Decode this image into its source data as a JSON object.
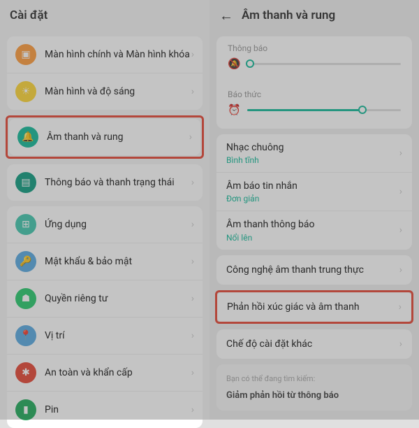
{
  "left": {
    "title": "Cài đặt",
    "groups": [
      [
        {
          "icon": "image-icon",
          "color": "icon-orange",
          "label": "Màn hình chính và Màn hình khóa"
        },
        {
          "icon": "brightness-icon",
          "color": "icon-yellow",
          "label": "Màn hình và độ sáng"
        }
      ],
      [
        {
          "icon": "bell-icon",
          "color": "icon-green",
          "label": "Âm thanh và rung",
          "highlight": true
        }
      ],
      [
        {
          "icon": "notification-icon",
          "color": "icon-teal-d",
          "label": "Thông báo và thanh trạng thái"
        }
      ],
      [
        {
          "icon": "apps-icon",
          "color": "icon-teal",
          "label": "Ứng dụng"
        },
        {
          "icon": "lock-icon",
          "color": "icon-blue",
          "label": "Mật khẩu & bảo mật"
        },
        {
          "icon": "privacy-icon",
          "color": "icon-greenl",
          "label": "Quyền riêng tư"
        },
        {
          "icon": "location-icon",
          "color": "icon-blue",
          "label": "Vị trí"
        },
        {
          "icon": "emergency-icon",
          "color": "icon-red",
          "label": "An toàn và khẩn cấp"
        },
        {
          "icon": "battery-icon",
          "color": "icon-greenb",
          "label": "Pin"
        }
      ]
    ]
  },
  "right": {
    "title": "Âm thanh và rung",
    "sliders": [
      {
        "label": "Thông báo",
        "icon": "bell-off-icon",
        "value": 2
      },
      {
        "label": "Báo thức",
        "icon": "alarm-icon",
        "value": 75
      }
    ],
    "sound_rows": [
      {
        "label": "Nhạc chuông",
        "sub": "Bình tĩnh"
      },
      {
        "label": "Âm báo tin nhắn",
        "sub": "Đơn giản"
      },
      {
        "label": "Âm thanh thông báo",
        "sub": "Nổi lên"
      }
    ],
    "more_rows": [
      {
        "label": "Công nghệ âm thanh trung thực"
      },
      {
        "label": "Phản hồi xúc giác và âm thanh",
        "highlight": true
      },
      {
        "label": "Chế độ cài đặt khác"
      }
    ],
    "hint_small": "Bạn có thể đang tìm kiếm:",
    "hint_main": "Giảm phản hồi từ thông báo"
  }
}
